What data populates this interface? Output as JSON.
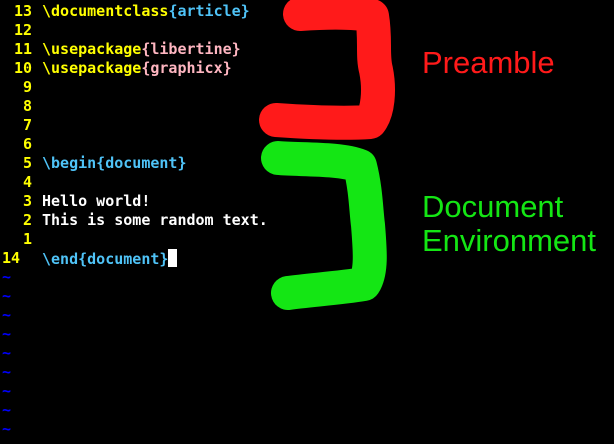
{
  "colors": {
    "background": "#000000",
    "line_number": "#ffff00",
    "command": "#ffff00",
    "group": "#4fc3f7",
    "argument": "#ffb6c1",
    "plain_text": "#ffffff",
    "tilde": "#0000ff",
    "preamble_annotation": "#ff1a1a",
    "document_annotation": "#14e614"
  },
  "editor": {
    "lines": [
      {
        "num": "13",
        "parts": [
          {
            "t": "\\documentclass",
            "c": "command"
          },
          {
            "t": "{article}",
            "c": "group"
          }
        ]
      },
      {
        "num": "12",
        "parts": []
      },
      {
        "num": "11",
        "parts": [
          {
            "t": "\\usepackage",
            "c": "command"
          },
          {
            "t": "{libertine}",
            "c": "argument"
          }
        ]
      },
      {
        "num": "10",
        "parts": [
          {
            "t": "\\usepackage",
            "c": "command"
          },
          {
            "t": "{graphicx}",
            "c": "argument"
          }
        ]
      },
      {
        "num": "9",
        "parts": []
      },
      {
        "num": "8",
        "parts": []
      },
      {
        "num": "7",
        "parts": []
      },
      {
        "num": "6",
        "parts": []
      },
      {
        "num": "5",
        "parts": [
          {
            "t": "\\begin{document}",
            "c": "group"
          }
        ]
      },
      {
        "num": "4",
        "parts": []
      },
      {
        "num": "3",
        "parts": [
          {
            "t": "Hello world!",
            "c": "plain_text"
          }
        ]
      },
      {
        "num": "2",
        "parts": [
          {
            "t": "This is some random text.",
            "c": "plain_text"
          }
        ]
      },
      {
        "num": "1",
        "parts": []
      },
      {
        "num": "14",
        "current": true,
        "parts": [
          {
            "t": "\\end{document}",
            "c": "group"
          }
        ],
        "cursor": true
      }
    ],
    "tilde_lines": [
      "~",
      "~",
      "~",
      "~",
      "~",
      "~",
      "~",
      "~",
      "~"
    ]
  },
  "annotations": {
    "preamble": {
      "text": "Preamble"
    },
    "document": {
      "line1": "Document",
      "line2": "Environment"
    }
  }
}
